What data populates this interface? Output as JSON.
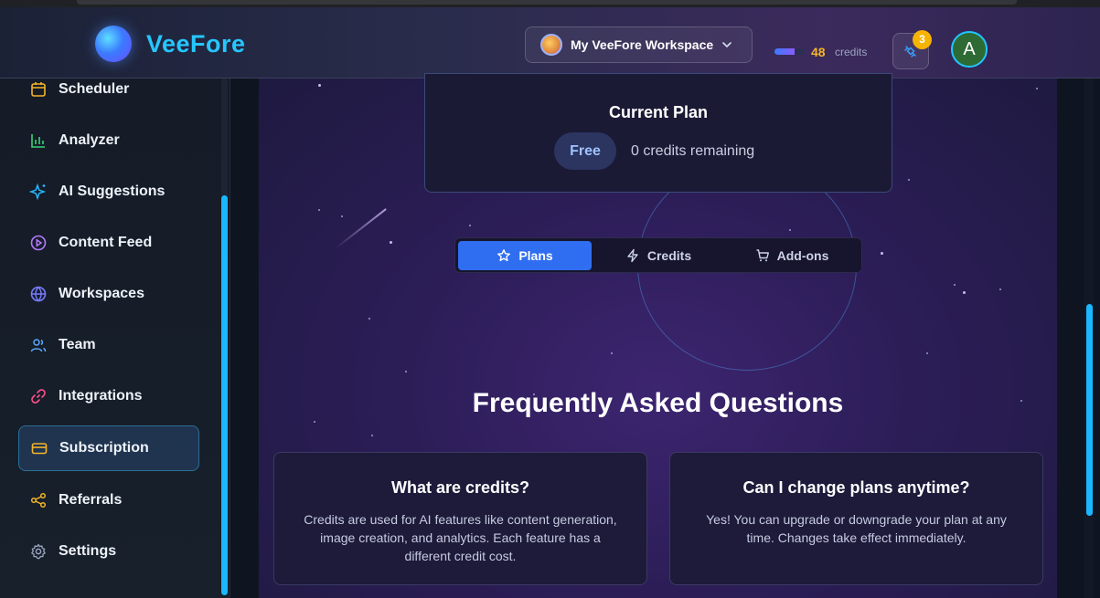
{
  "app": {
    "name": "VeeFore"
  },
  "header": {
    "workspace_label": "My VeeFore Workspace",
    "credits_count": "48",
    "credits_label": "credits",
    "credits_fill_fraction": 0.7,
    "notifications_count": "3",
    "user_initial": "A"
  },
  "sidebar": {
    "items": [
      {
        "label": "Scheduler",
        "icon": "calendar-icon",
        "color": "#f5b428"
      },
      {
        "label": "Analyzer",
        "icon": "bar-chart-icon",
        "color": "#3ad27a"
      },
      {
        "label": "AI Suggestions",
        "icon": "sparkles-icon",
        "color": "#26b8ff"
      },
      {
        "label": "Content Feed",
        "icon": "play-circle-icon",
        "color": "#b57bff"
      },
      {
        "label": "Workspaces",
        "icon": "globe-icon",
        "color": "#7a7cff"
      },
      {
        "label": "Team",
        "icon": "users-icon",
        "color": "#5aa8ff"
      },
      {
        "label": "Integrations",
        "icon": "link-icon",
        "color": "#ff4f8b"
      },
      {
        "label": "Subscription",
        "icon": "credit-card-icon",
        "color": "#f5b428",
        "active": true
      },
      {
        "label": "Referrals",
        "icon": "share-icon",
        "color": "#f5b428"
      },
      {
        "label": "Settings",
        "icon": "gear-icon",
        "color": "#9aa4bf"
      }
    ]
  },
  "plan": {
    "title": "Current Plan",
    "badge": "Free",
    "remaining": "0 credits remaining"
  },
  "tabs": [
    {
      "label": "Plans",
      "icon": "star-icon",
      "active": true
    },
    {
      "label": "Credits",
      "icon": "lightning-icon",
      "active": false
    },
    {
      "label": "Add-ons",
      "icon": "cart-icon",
      "active": false
    }
  ],
  "faq": {
    "title": "Frequently Asked Questions",
    "items": [
      {
        "question": "What are credits?",
        "answer": "Credits are used for AI features like content generation, image creation, and analytics. Each feature has a different credit cost."
      },
      {
        "question": "Can I change plans anytime?",
        "answer": "Yes! You can upgrade or downgrade your plan at any time. Changes take effect immediately."
      }
    ]
  }
}
